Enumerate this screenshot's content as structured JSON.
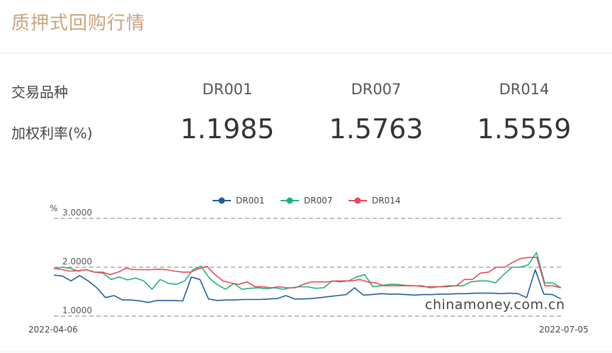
{
  "header": {
    "title": "质押式回购行情"
  },
  "table": {
    "row_label_type": "交易品种",
    "row_label_rate": "加权利率(%)",
    "columns": [
      {
        "name": "DR001",
        "rate": "1.1985"
      },
      {
        "name": "DR007",
        "rate": "1.5763"
      },
      {
        "name": "DR014",
        "rate": "1.5559"
      }
    ]
  },
  "chart_data": {
    "type": "line",
    "ylabel": "%",
    "ylim": [
      1.0,
      3.0
    ],
    "yticks": [
      "3.0000",
      "2.0000",
      "1.0000"
    ],
    "x_start_label": "2022-04-06",
    "x_end_label": "2022-07-05",
    "watermark": "chinamoney.com.cn",
    "grid": true,
    "legend_position": "top-center",
    "series": [
      {
        "name": "DR001",
        "color": "#1f5f99",
        "values": [
          1.84,
          1.82,
          1.72,
          1.83,
          1.72,
          1.58,
          1.38,
          1.42,
          1.33,
          1.33,
          1.31,
          1.28,
          1.32,
          1.32,
          1.32,
          1.31,
          1.8,
          1.75,
          1.35,
          1.32,
          1.33,
          1.33,
          1.34,
          1.34,
          1.34,
          1.35,
          1.36,
          1.42,
          1.35,
          1.35,
          1.36,
          1.38,
          1.4,
          1.42,
          1.44,
          1.58,
          1.43,
          1.44,
          1.46,
          1.45,
          1.45,
          1.44,
          1.43,
          1.44,
          1.44,
          1.45,
          1.45,
          1.46,
          1.46,
          1.47,
          1.47,
          1.47,
          1.46,
          1.47,
          1.46,
          1.38,
          1.95,
          1.45,
          1.44,
          1.35
        ]
      },
      {
        "name": "DR007",
        "color": "#22b07d",
        "values": [
          1.97,
          2.0,
          1.98,
          1.92,
          1.95,
          1.9,
          1.88,
          1.75,
          1.8,
          1.74,
          1.78,
          1.72,
          1.55,
          1.75,
          1.67,
          1.65,
          1.72,
          1.95,
          2.02,
          1.78,
          1.64,
          1.55,
          1.67,
          1.55,
          1.57,
          1.58,
          1.56,
          1.58,
          1.55,
          1.58,
          1.6,
          1.6,
          1.57,
          1.58,
          1.72,
          1.7,
          1.72,
          1.8,
          1.85,
          1.6,
          1.62,
          1.65,
          1.65,
          1.63,
          1.62,
          1.62,
          1.58,
          1.6,
          1.6,
          1.62,
          1.62,
          1.7,
          1.72,
          1.72,
          1.68,
          1.85,
          2.0,
          2.0,
          2.05,
          2.3,
          1.68,
          1.68,
          1.58
        ]
      },
      {
        "name": "DR014",
        "color": "#e84a5a",
        "values": [
          1.98,
          1.95,
          1.92,
          1.93,
          1.95,
          1.9,
          1.9,
          1.85,
          1.9,
          1.98,
          1.95,
          1.95,
          1.95,
          1.96,
          1.95,
          1.92,
          1.9,
          1.9,
          1.97,
          2.02,
          1.85,
          1.72,
          1.68,
          1.65,
          1.7,
          1.6,
          1.6,
          1.58,
          1.6,
          1.58,
          1.58,
          1.65,
          1.7,
          1.7,
          1.7,
          1.72,
          1.72,
          1.72,
          1.75,
          1.7,
          1.68,
          1.62,
          1.62,
          1.62,
          1.62,
          1.62,
          1.6,
          1.6,
          1.6,
          1.62,
          1.62,
          1.75,
          1.75,
          1.88,
          1.9,
          2.0,
          2.0,
          2.1,
          2.18,
          2.2,
          2.2,
          1.62,
          1.62,
          1.58
        ]
      }
    ]
  }
}
